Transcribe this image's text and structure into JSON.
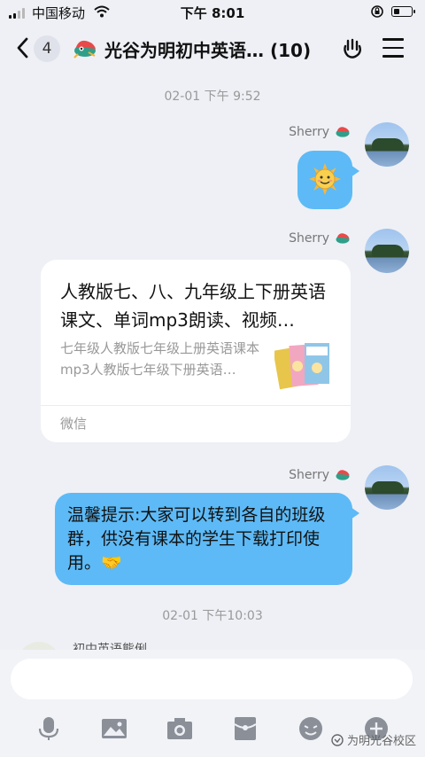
{
  "status_bar": {
    "carrier": "中国移动",
    "time": "下午 8:01",
    "battery_level": 0.35
  },
  "header": {
    "unread_count": "4",
    "title": "光谷为明初中英语…",
    "member_count": "(10)"
  },
  "messages": {
    "time_1": "02-01 下午 9:52",
    "sender_1": "Sherry",
    "emoji_1": "sun-smile-emoji",
    "sender_2": "Sherry",
    "card": {
      "title": "人教版七、八、九年级上下册英语课文、单词mp3朗读、视频…",
      "description": "七年级人教版七年级上册英语课本mp3人教版七年级下册英语…",
      "source": "微信"
    },
    "sender_3": "Sherry",
    "text_3": "温馨提示:大家可以转到各自的班级群，供没有课本的学生下载打印使用。🤝",
    "time_2": "02-01 下午10:03",
    "partial_text": "初中英语熊俐"
  },
  "composer": {
    "input_value": "",
    "input_placeholder": ""
  },
  "watermark": "为明光谷校区",
  "colors": {
    "bubble": "#5dbaf6",
    "background": "#eef0f5",
    "card": "#ffffff"
  }
}
